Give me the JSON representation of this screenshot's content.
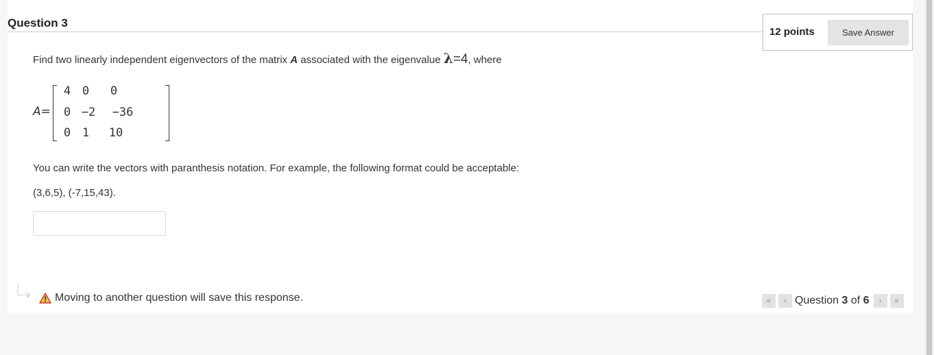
{
  "question": {
    "title": "Question 3",
    "points": "12 points",
    "save_label": "Save Answer",
    "prompt_before": "Find two linearly independent eigenvectors of the matrix ",
    "matrix_name": "A",
    "prompt_middle": " associated with the eigenvalue ",
    "lambda_symbol": "λ",
    "eigen_eq": "=4",
    "prompt_after": ", where",
    "matrix_label_var": "A",
    "matrix_label_eq": "=",
    "matrix": [
      [
        "4",
        "0",
        "0"
      ],
      [
        "0",
        "−2",
        "−36"
      ],
      [
        "0",
        "1",
        "10"
      ]
    ],
    "instructions": "You can write the vectors with paranthesis notation. For example, the following format could be acceptable:",
    "example": "(3,6,5), (-7,15,43).",
    "answer_value": "",
    "answer_placeholder": ""
  },
  "footer": {
    "warning": "Moving to another question will save this response.",
    "nav_prefix": "Question ",
    "nav_current": "3",
    "nav_of": " of ",
    "nav_total": "6",
    "first_icon": "«",
    "prev_icon": "‹",
    "next_icon": "›",
    "last_icon": "»"
  }
}
